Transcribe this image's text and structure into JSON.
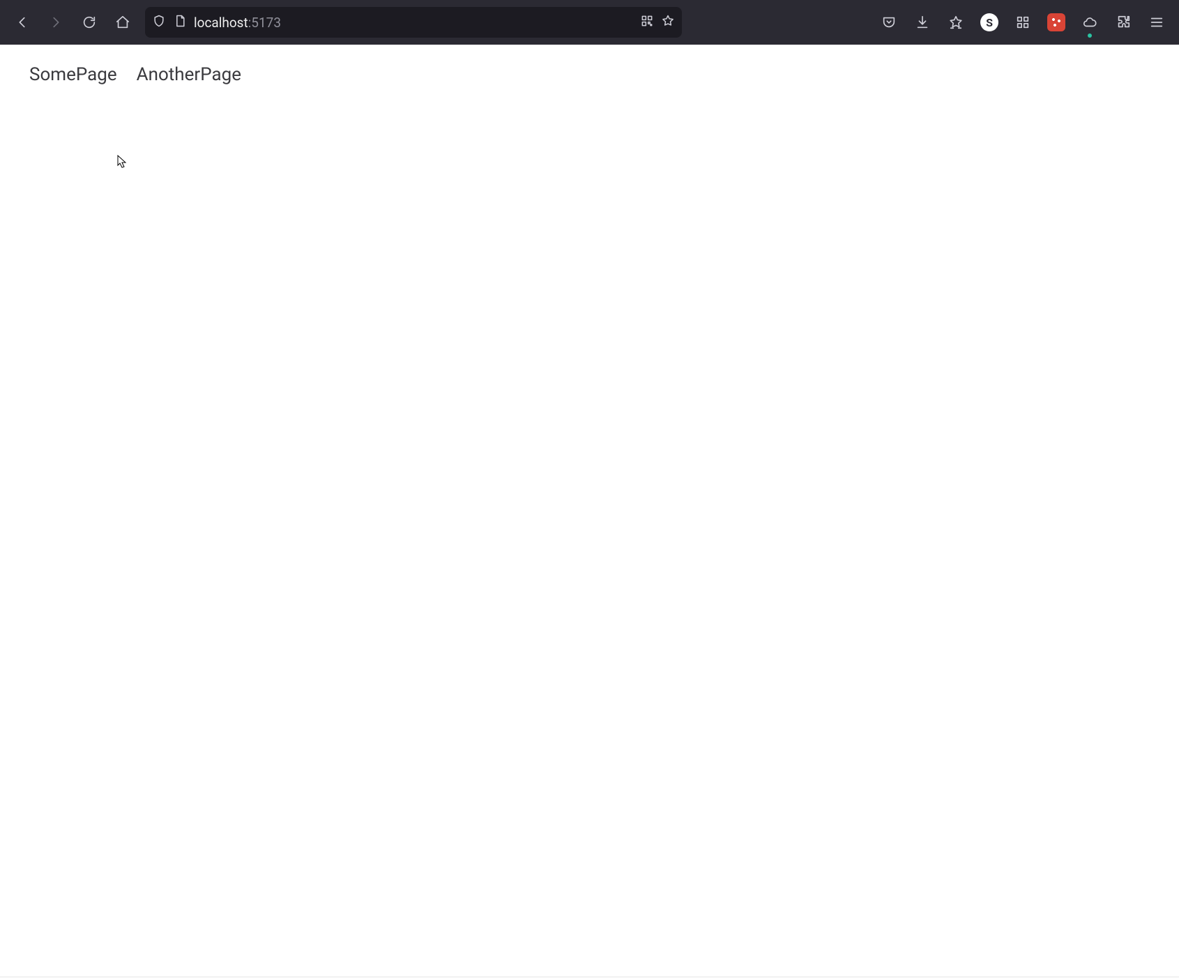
{
  "browser": {
    "nav": {
      "back_icon": "arrow-left",
      "forward_icon": "arrow-right",
      "reload_icon": "reload",
      "home_icon": "home"
    },
    "address_bar": {
      "shield_icon": "shield",
      "page_icon": "page",
      "host": "localhost",
      "port": ":5173",
      "qr_icon": "qr",
      "bookmark_icon": "star"
    },
    "toolbar_right": {
      "pocket_icon": "pocket",
      "downloads_icon": "download",
      "bookmarks_icon": "star-lines",
      "ext_s_label": "S",
      "ext_tiles_icon": "tiles",
      "ext_red_icon": "noscript",
      "cloud_icon": "cloud",
      "extensions_icon": "puzzle",
      "menu_icon": "hamburger"
    }
  },
  "page": {
    "nav_links": [
      {
        "label": "SomePage"
      },
      {
        "label": "AnotherPage"
      }
    ]
  }
}
